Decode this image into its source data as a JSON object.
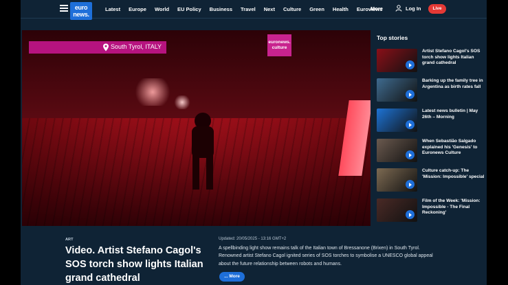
{
  "header": {
    "logo_line1": "euro",
    "logo_line2": "news.",
    "nav": [
      "Latest",
      "Europe",
      "World",
      "EU Policy",
      "Business",
      "Travel",
      "Next",
      "Culture",
      "Green",
      "Health",
      "Euroviews"
    ],
    "more_label": "More",
    "login_label": "Log In",
    "live_label": "Live"
  },
  "video": {
    "location": "South Tyrol, ITALY",
    "badge_line1": "euronews.",
    "badge_line2": "culture"
  },
  "sidebar": {
    "heading": "Top stories",
    "stories": [
      {
        "title": "Artist Stefano Cagol's SOS torch show lights Italian grand cathedral"
      },
      {
        "title": "Barking up the family tree in Argentina as birth rates fall"
      },
      {
        "title": "Latest news bulletin | May 26th – Morning"
      },
      {
        "title": "When Sebastião Salgado explained his 'Genesis' to Euronews Culture"
      },
      {
        "title": "Culture catch-up: The 'Mission: Impossible' special"
      },
      {
        "title": "Film of the Week: 'Mission: Impossible - The Final Reckoning'"
      }
    ],
    "thumb_colors": [
      "#8a0f18",
      "#3f6b8f",
      "#1d73d6",
      "#6b5a4f",
      "#7d6a52",
      "#4a2a26"
    ]
  },
  "article": {
    "category": "ART",
    "headline": "Video. Artist Stefano Cagol's SOS torch show lights Italian grand cathedral",
    "updated": "Updated: 20/05/2025 - 13:16 GMT+2",
    "summary": "A spellbinding light show remains talk of the Italian town of Bressanone (Brixen) in South Tyrol. Renowned artist Stefano Cagol ignited series of SOS torches to symbolise a UNESCO global appeal about the future relationship between robots and humans.",
    "more_label": "... More"
  }
}
